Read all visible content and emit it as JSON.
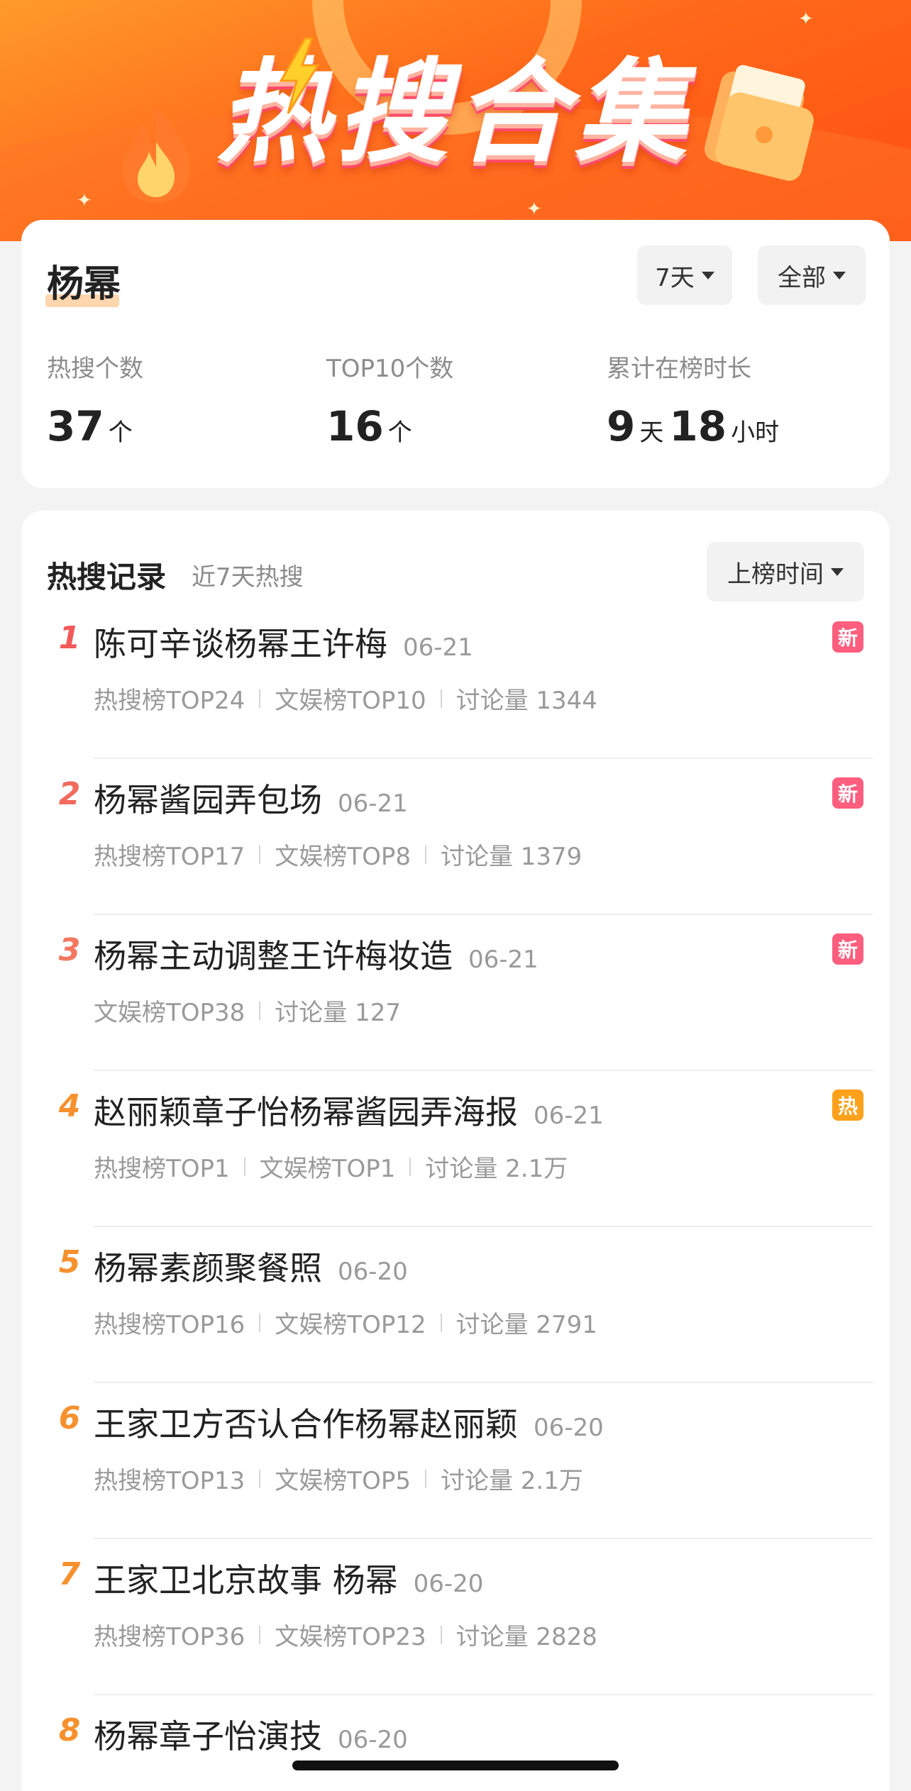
{
  "banner": {
    "title": "热搜合集",
    "colors": {
      "start": "#ff9a2b",
      "end": "#ff4d12"
    }
  },
  "profile": {
    "name": "杨幂",
    "filters": {
      "days": "7天",
      "scope": "全部"
    },
    "stats": [
      {
        "label": "热搜个数",
        "value": "37",
        "unit": "个"
      },
      {
        "label": "TOP10个数",
        "value": "16",
        "unit": "个"
      },
      {
        "label": "累计在榜时长",
        "days": "9",
        "days_unit": "天",
        "hours": "18",
        "hours_unit": "小时"
      }
    ]
  },
  "records": {
    "title": "热搜记录",
    "subtitle": "近7天热搜",
    "sort_label": "上榜时间",
    "items": [
      {
        "rank": "1",
        "title": "陈可辛谈杨幂王许梅",
        "date": "06-21",
        "badge": "新",
        "badge_type": "new",
        "meta": [
          "热搜榜TOP24",
          "文娱榜TOP10",
          "讨论量 1344"
        ]
      },
      {
        "rank": "2",
        "title": "杨幂酱园弄包场",
        "date": "06-21",
        "badge": "新",
        "badge_type": "new",
        "meta": [
          "热搜榜TOP17",
          "文娱榜TOP8",
          "讨论量 1379"
        ]
      },
      {
        "rank": "3",
        "title": "杨幂主动调整王许梅妆造",
        "date": "06-21",
        "badge": "新",
        "badge_type": "new",
        "meta": [
          "文娱榜TOP38",
          "讨论量 127"
        ]
      },
      {
        "rank": "4",
        "title": "赵丽颖章子怡杨幂酱园弄海报",
        "date": "06-21",
        "badge": "热",
        "badge_type": "hot",
        "meta": [
          "热搜榜TOP1",
          "文娱榜TOP1",
          "讨论量 2.1万"
        ]
      },
      {
        "rank": "5",
        "title": "杨幂素颜聚餐照",
        "date": "06-20",
        "badge": "",
        "badge_type": "",
        "meta": [
          "热搜榜TOP16",
          "文娱榜TOP12",
          "讨论量 2791"
        ]
      },
      {
        "rank": "6",
        "title": "王家卫方否认合作杨幂赵丽颖",
        "date": "06-20",
        "badge": "",
        "badge_type": "",
        "meta": [
          "热搜榜TOP13",
          "文娱榜TOP5",
          "讨论量 2.1万"
        ]
      },
      {
        "rank": "7",
        "title": "王家卫北京故事 杨幂",
        "date": "06-20",
        "badge": "",
        "badge_type": "",
        "meta": [
          "热搜榜TOP36",
          "文娱榜TOP23",
          "讨论量 2828"
        ]
      },
      {
        "rank": "8",
        "title": "杨幂章子怡演技",
        "date": "06-20",
        "badge": "",
        "badge_type": "",
        "meta": []
      }
    ]
  }
}
